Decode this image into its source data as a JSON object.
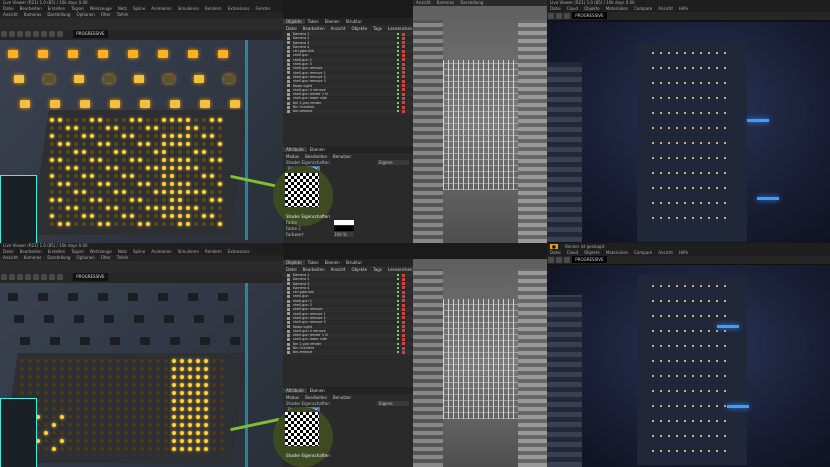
{
  "top": {
    "title": "Live Viewer (R21) 1.0 (85) / 10k days 0.00",
    "menus": [
      "Datei",
      "Bearbeiten",
      "Erstellen",
      "Tagsel",
      "Werkzeuge",
      "Netz",
      "Spline",
      "Animieren",
      "Simulieren",
      "Rendern",
      "Extensions",
      "Fenster",
      "Hilfe"
    ],
    "viewport_menus": [
      "Ansicht",
      "Kameras",
      "Darstellung",
      "Optionen",
      "Filter",
      "Tafeln"
    ],
    "mode": "PROGRESSIVE",
    "tabs": [
      "Objekte",
      "Takes",
      "Ebenen",
      "Struktur"
    ],
    "toolbar": [
      "Datei",
      "Bearbeiten",
      "Ansicht",
      "Objekte",
      "Tags",
      "Lesezeichen"
    ],
    "objects": [
      "Kamera 1",
      "Kamera 2",
      "Kamera 3",
      "Kamera 4",
      "ctrl-pgw-link",
      "shell-gun",
      "shell-gun 2",
      "shell-gun 3",
      "shell-gun remove",
      "shell-gun remove 1",
      "shell-gun remove 2",
      "shell-gun remove 3",
      "Noise Light",
      "shell-gun 4 remove",
      "shell-gun render 1 hl",
      "shell-gun lower side",
      "bin 1 gun render",
      "Bin Gradient",
      "bin-remove"
    ],
    "attr_tabs": [
      "Attribute",
      "Ebenen"
    ],
    "attr_menu": [
      "Modus",
      "Bearbeiten",
      "Benutzer"
    ],
    "attr_title": "Shader Eigenschaften",
    "attr_btn": "Basis",
    "attr_active": "Shader",
    "search_label": "Eigene",
    "shader_section": "Shader Eigenschaften",
    "field_labels": [
      "Farbe",
      "Farbe 2",
      "Farbwert"
    ],
    "field_value": "100 %",
    "render_title": "Live Viewer (R21) 1.0 (85) / 10k days 0.00",
    "render_menu": [
      "Datei",
      "Cloud",
      "Objekte",
      "Materialien",
      "Compare",
      "Ansicht",
      "Hilfe"
    ],
    "render_mode": "PROGRESSIVE"
  },
  "bottom": {
    "title": "Live Viewer (R21) 1.0 (85) / 10k days 0.00",
    "menus": [
      "Datei",
      "Bearbeiten",
      "Erstellen",
      "Tagsel",
      "Werkzeuge",
      "Netz",
      "Spline",
      "Animieren",
      "Simulieren",
      "Rendern",
      "Extensions",
      "Fenster",
      "Hilfe"
    ],
    "viewport_menus": [
      "Ansicht",
      "Kameras",
      "Darstellung",
      "Optionen",
      "Filter",
      "Tafeln"
    ],
    "mode": "PROGRESSIVE",
    "tabs": [
      "Objekte",
      "Takes",
      "Ebenen",
      "Struktur"
    ],
    "toolbar": [
      "Datei",
      "Bearbeiten",
      "Ansicht",
      "Objekte",
      "Tags",
      "Lesezeichen"
    ],
    "objects": [
      "Kamera 1",
      "Kamera 2",
      "Kamera 3",
      "Kamera 4",
      "ctrl-pgw-link",
      "shell-gun",
      "shell-gun 2",
      "shell-gun 3",
      "shell-gun remove",
      "shell-gun remove 1",
      "shell-gun remove 2",
      "shell-gun remove 3",
      "Noise Light",
      "shell-gun 4 remove",
      "shell-gun render 1 hl",
      "shell-gun lower side",
      "bin 1 gun render",
      "Bin Gradient",
      "bin-remove"
    ],
    "attr_tabs": [
      "Attribute",
      "Ebenen"
    ],
    "attr_menu": [
      "Modus",
      "Bearbeiten",
      "Benutzer"
    ],
    "attr_title": "Shader Eigenschaften",
    "attr_btn": "Basis",
    "attr_active": "Shader",
    "search_label": "Eigene",
    "shader_section": "Shader Eigenschaften",
    "render_status": "Render ist gestoppt",
    "render_menu": [
      "Datei",
      "Cloud",
      "Objekte",
      "Materialien",
      "Compare",
      "Ansicht",
      "Hilfe"
    ],
    "render_mode": "PROGRESSIVE"
  },
  "icons": [
    "qr-code-icon",
    "arrow-icon"
  ],
  "colors": {
    "led": "#ffd23a",
    "arrow": "#7cc030",
    "blue_light": "#3aa0ff",
    "bg": "#2b2b2b"
  }
}
